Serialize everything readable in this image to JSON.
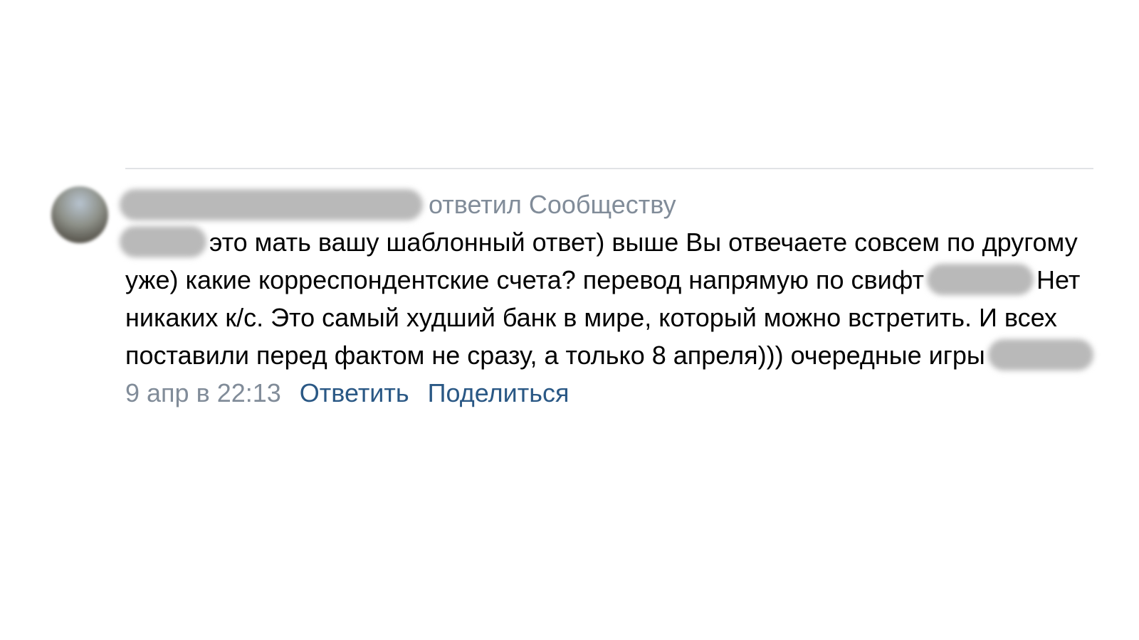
{
  "comment": {
    "replied_label": "ответил Сообществу",
    "text": {
      "part1": "это мать вашу шаблонный ответ) выше Вы отвечаете совсем по другому уже) какие корреспондентские счета? перевод напрямую по свифт",
      "part2": "Нет никаких к/с. Это самый худший банк в мире, который можно встретить. И всех поставили перед фактом не сразу, а только 8 апреля))) очередные игры"
    },
    "footer": {
      "timestamp": "9 апр в 22:13",
      "reply_label": "Ответить",
      "share_label": "Поделиться"
    }
  }
}
